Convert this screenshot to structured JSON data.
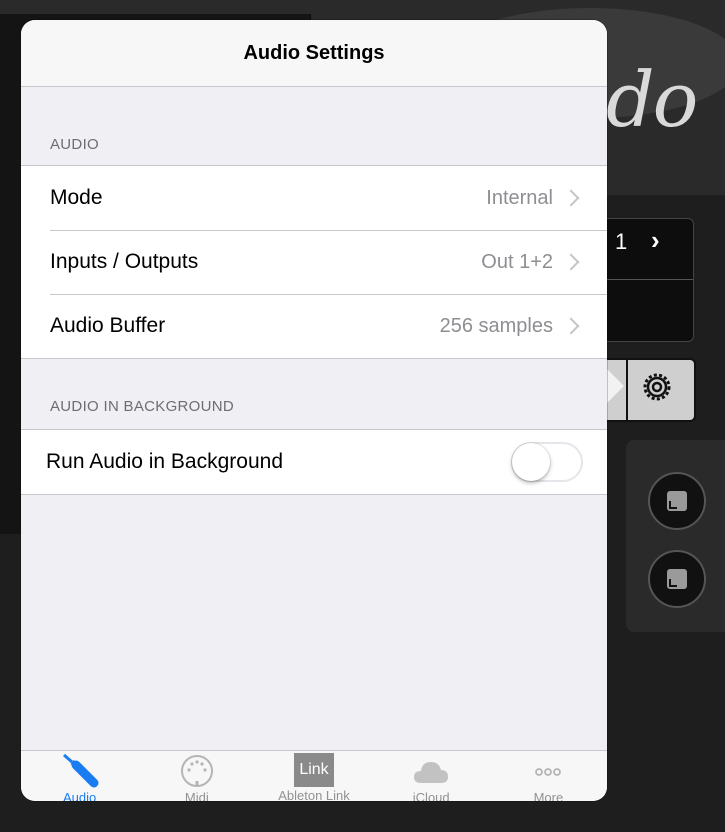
{
  "background": {
    "logo_text": "do",
    "stepper_value": "1",
    "stepper_chevron": "›"
  },
  "popover": {
    "title": "Audio Settings",
    "sections": [
      {
        "header": "AUDIO",
        "rows": [
          {
            "label": "Mode",
            "value": "Internal"
          },
          {
            "label": "Inputs / Outputs",
            "value": "Out 1+2"
          },
          {
            "label": "Audio Buffer",
            "value": "256 samples"
          }
        ]
      },
      {
        "header": "AUDIO IN BACKGROUND",
        "rows": [
          {
            "label": "Run Audio in Background",
            "toggle": false
          }
        ]
      }
    ]
  },
  "tabbar": {
    "items": [
      {
        "label": "Audio",
        "icon": "audio-jack-icon",
        "active": true
      },
      {
        "label": "Midi",
        "icon": "midi-connector-icon",
        "active": false
      },
      {
        "label": "Ableton Link",
        "icon": "ableton-link-icon",
        "icon_text": "Link",
        "active": false
      },
      {
        "label": "iCloud",
        "icon": "cloud-icon",
        "active": false
      },
      {
        "label": "More",
        "icon": "more-icon",
        "active": false
      }
    ]
  },
  "colors": {
    "accent": "#1a7cf2",
    "inactive": "#929292",
    "background": "#1e1e1f"
  }
}
